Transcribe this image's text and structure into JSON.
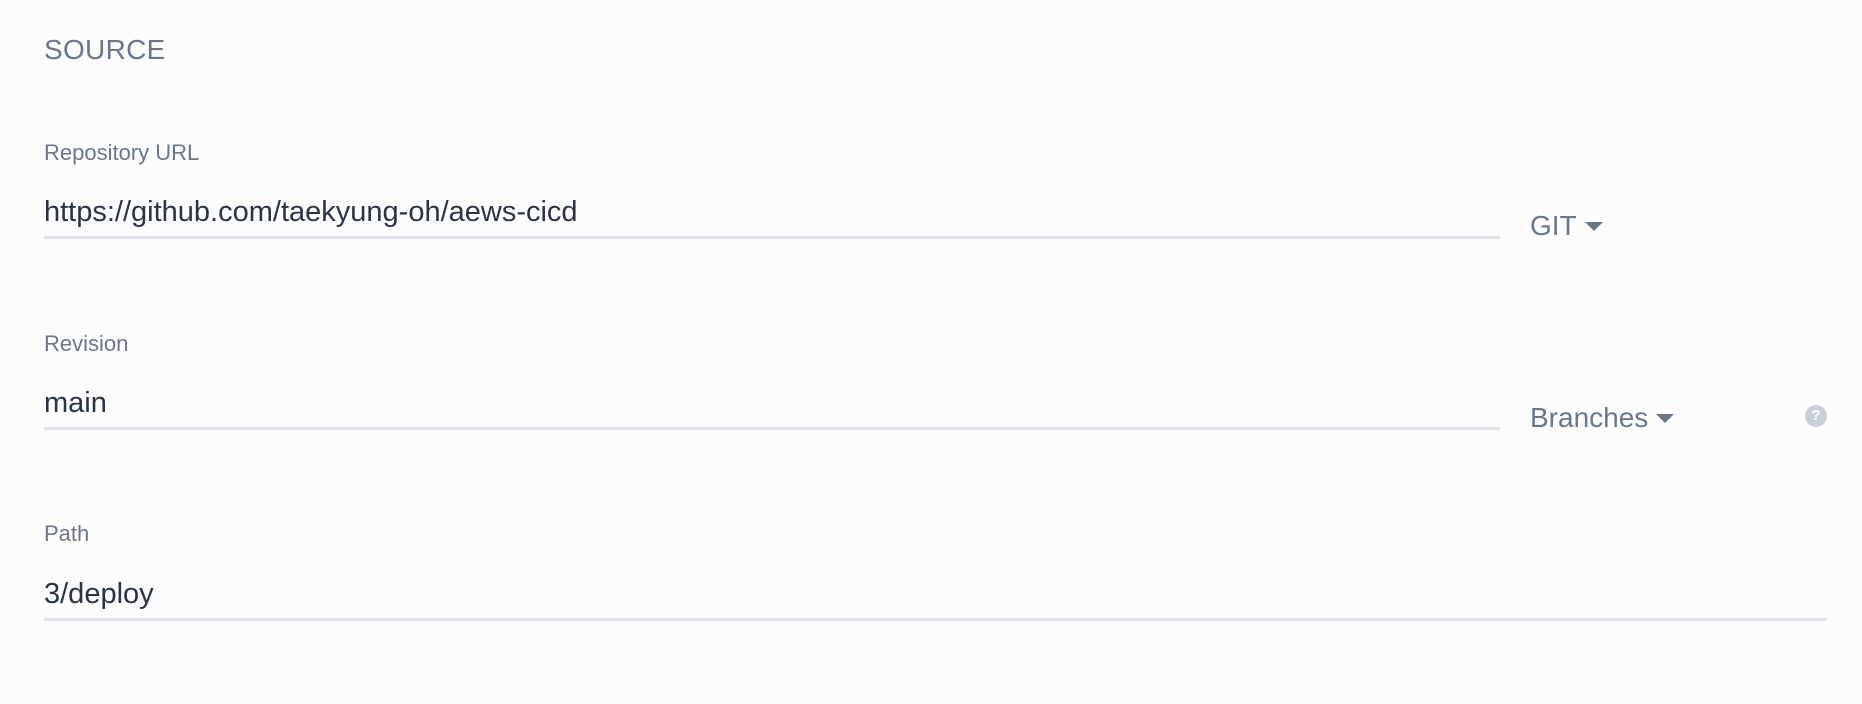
{
  "section": {
    "title": "SOURCE"
  },
  "repository": {
    "label": "Repository URL",
    "value": "https://github.com/taekyung-oh/aews-cicd",
    "type_dropdown": "GIT"
  },
  "revision": {
    "label": "Revision",
    "value": "main",
    "ref_dropdown": "Branches",
    "help_icon": "?"
  },
  "path": {
    "label": "Path",
    "value": "3/deploy"
  },
  "icons": {
    "caret": "caret-down-icon",
    "help": "question-circle-icon"
  }
}
